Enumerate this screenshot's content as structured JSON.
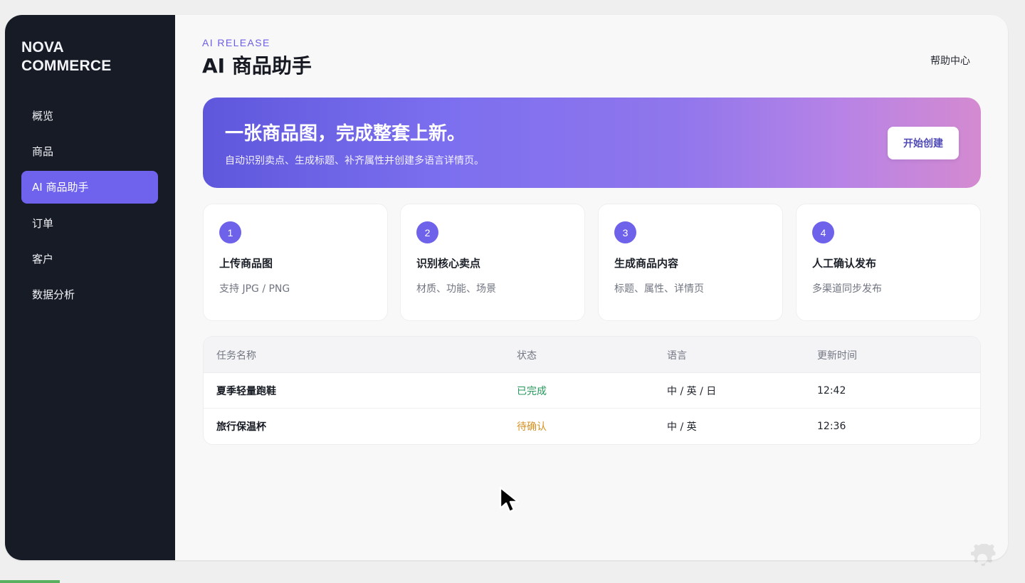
{
  "sidebar": {
    "brand": {
      "line1": "NOVA",
      "line2": "COMMERCE"
    },
    "items": [
      {
        "label": "概览",
        "active": false
      },
      {
        "label": "商品",
        "active": false
      },
      {
        "label": "AI 商品助手",
        "active": true
      },
      {
        "label": "订单",
        "active": false
      },
      {
        "label": "客户",
        "active": false
      },
      {
        "label": "数据分析",
        "active": false
      }
    ]
  },
  "header": {
    "eyebrow": "AI RELEASE",
    "title": "AI 商品助手",
    "help_label": "帮助中心"
  },
  "hero": {
    "title": "一张商品图，完成整套上新。",
    "subtitle": "自动识别卖点、生成标题、补齐属性并创建多语言详情页。",
    "button_label": "开始创建"
  },
  "steps": [
    {
      "number": "1",
      "title": "上传商品图",
      "description": "支持 JPG / PNG"
    },
    {
      "number": "2",
      "title": "识别核心卖点",
      "description": "材质、功能、场景"
    },
    {
      "number": "3",
      "title": "生成商品内容",
      "description": "标题、属性、详情页"
    },
    {
      "number": "4",
      "title": "人工确认发布",
      "description": "多渠道同步发布"
    }
  ],
  "table": {
    "headers": {
      "name": "任务名称",
      "status": "状态",
      "language": "语言",
      "updated": "更新时间"
    },
    "rows": [
      {
        "name": "夏季轻量跑鞋",
        "status": "已完成",
        "status_color": "#24985b",
        "language": "中 / 英 / 日",
        "updated": "12:42"
      },
      {
        "name": "旅行保温杯",
        "status": "待确认",
        "status_color": "#d59223",
        "language": "中 / 英",
        "updated": "12:36"
      }
    ]
  },
  "colors": {
    "sidebar_background": "#171b25",
    "accent": "#6f63ee",
    "success": "#24985b",
    "warning": "#d59223"
  },
  "icons": {
    "cursor": "mouse-pointer-icon",
    "settings": "settings-gear-icon"
  }
}
